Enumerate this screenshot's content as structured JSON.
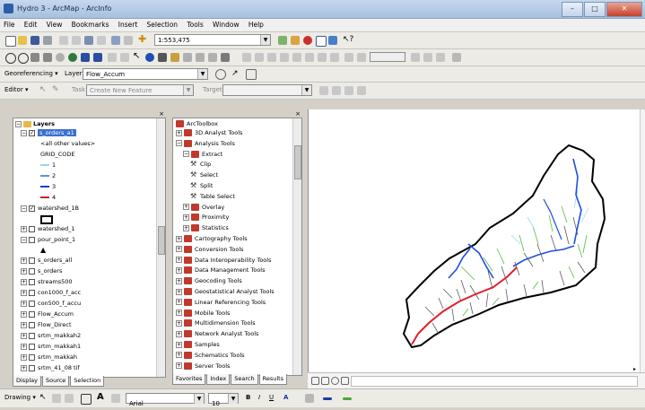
{
  "window": {
    "title": "Hydro 3 - ArcMap - ArcInfo",
    "minimize": "–",
    "maximize": "□",
    "close": "✕"
  },
  "menu": [
    "File",
    "Edit",
    "View",
    "Bookmarks",
    "Insert",
    "Selection",
    "Tools",
    "Window",
    "Help"
  ],
  "standard_toolbar": {
    "scale": "1:553,475"
  },
  "georef_toolbar": {
    "label": "Georeferencing ▾",
    "layer_label": "Layer:",
    "layer_value": "Flow_Accum"
  },
  "editor_toolbar": {
    "editor_label": "Editor ▾",
    "task_label": "Task:",
    "task_value": "Create New Feature",
    "target_label": "Target:"
  },
  "toc": {
    "root": "Layers",
    "items": [
      {
        "label": "s_orders_a1",
        "checked": true,
        "selected": true,
        "expanded": true
      },
      {
        "label": "<all other values>",
        "legend": true
      },
      {
        "label": "GRID_CODE",
        "legend": true
      },
      {
        "label": "1",
        "legend": true,
        "color": "#9fd3f0"
      },
      {
        "label": "2",
        "legend": true,
        "color": "#6a8fd0"
      },
      {
        "label": "3",
        "legend": true,
        "color": "#1a3ad0"
      },
      {
        "label": "4",
        "legend": true,
        "color": "#d02020"
      },
      {
        "label": "watershed_1B",
        "checked": true,
        "expanded": true
      },
      {
        "label": "",
        "legend": true,
        "symbol": "box"
      },
      {
        "label": "watershed_1",
        "checked": false
      },
      {
        "label": "pour_point_1",
        "checked": false,
        "expanded": true
      },
      {
        "label": "",
        "legend": true,
        "symbol": "triangle"
      },
      {
        "label": "s_orders_all",
        "checked": false
      },
      {
        "label": "s_orders",
        "checked": false
      },
      {
        "label": "streams500",
        "checked": false
      },
      {
        "label": "con1000_f_acc",
        "checked": false
      },
      {
        "label": "con500_f_accu",
        "checked": false
      },
      {
        "label": "Flow_Accum",
        "checked": false
      },
      {
        "label": "Flow_Direct",
        "checked": false
      },
      {
        "label": "srtm_makkah2",
        "checked": false
      },
      {
        "label": "srtm_makkah1",
        "checked": false
      },
      {
        "label": "srtm_makkah",
        "checked": false
      },
      {
        "label": "srtm_41_08 tif",
        "checked": false
      }
    ],
    "tabs": [
      "Display",
      "Source",
      "Selection"
    ]
  },
  "toolbox": {
    "root": "ArcToolbox",
    "items": [
      {
        "label": "3D Analyst Tools",
        "level": 1,
        "kind": "box"
      },
      {
        "label": "Analysis Tools",
        "level": 1,
        "kind": "box",
        "expanded": true
      },
      {
        "label": "Extract",
        "level": 2,
        "kind": "box",
        "expanded": true
      },
      {
        "label": "Clip",
        "level": 3,
        "kind": "tool"
      },
      {
        "label": "Select",
        "level": 3,
        "kind": "tool"
      },
      {
        "label": "Split",
        "level": 3,
        "kind": "tool"
      },
      {
        "label": "Table Select",
        "level": 3,
        "kind": "tool"
      },
      {
        "label": "Overlay",
        "level": 2,
        "kind": "box"
      },
      {
        "label": "Proximity",
        "level": 2,
        "kind": "box"
      },
      {
        "label": "Statistics",
        "level": 2,
        "kind": "box"
      },
      {
        "label": "Cartography Tools",
        "level": 1,
        "kind": "box"
      },
      {
        "label": "Conversion Tools",
        "level": 1,
        "kind": "box"
      },
      {
        "label": "Data Interoperability Tools",
        "level": 1,
        "kind": "box"
      },
      {
        "label": "Data Management Tools",
        "level": 1,
        "kind": "box"
      },
      {
        "label": "Geocoding Tools",
        "level": 1,
        "kind": "box"
      },
      {
        "label": "Geostatistical Analyst Tools",
        "level": 1,
        "kind": "box"
      },
      {
        "label": "Linear Referencing Tools",
        "level": 1,
        "kind": "box"
      },
      {
        "label": "Mobile Tools",
        "level": 1,
        "kind": "box"
      },
      {
        "label": "Multidimension Tools",
        "level": 1,
        "kind": "box"
      },
      {
        "label": "Network Analyst Tools",
        "level": 1,
        "kind": "box"
      },
      {
        "label": "Samples",
        "level": 1,
        "kind": "box"
      },
      {
        "label": "Schematics Tools",
        "level": 1,
        "kind": "box"
      },
      {
        "label": "Server Tools",
        "level": 1,
        "kind": "box"
      }
    ],
    "tabs": [
      "Favorites",
      "Index",
      "Search",
      "Results"
    ]
  },
  "draw_toolbar": {
    "drawing_label": "Drawing ▾",
    "font": "Arial",
    "size": "10",
    "bold": "B",
    "italic": "I",
    "underline": "U",
    "font_color": "A"
  },
  "colors": {
    "titlebar": "#b6cbe6",
    "stream_red": "#e0202a",
    "stream_blue": "#1f4fe0",
    "stream_green": "#57b845"
  }
}
